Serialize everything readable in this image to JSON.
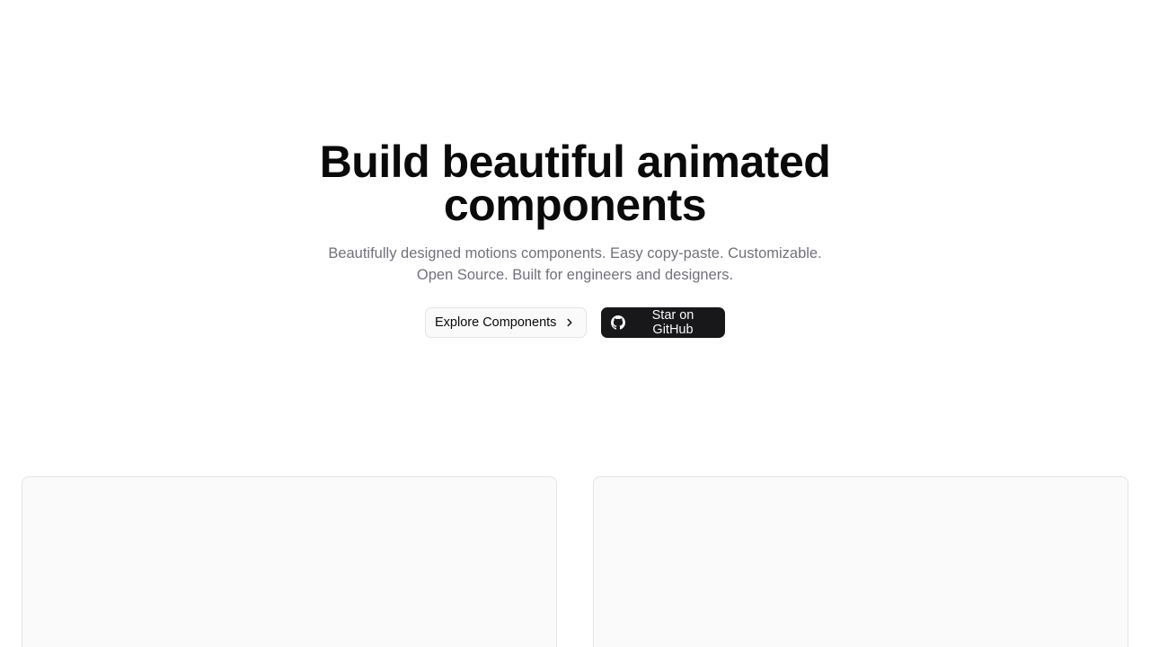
{
  "hero": {
    "title_line1": "Build beautiful animated",
    "title_line2": "components",
    "subtitle_line1": "Beautifully designed motions components. Easy copy-paste. Customizable.",
    "subtitle_line2": "Open Source. Built for engineers and designers."
  },
  "actions": {
    "explore_label": "Explore Components",
    "explore_icon": "chevron-right-icon",
    "github_label": "Star on GitHub",
    "github_icon": "github-icon"
  },
  "colors": {
    "background": "#ffffff",
    "heading": "#0a0a0a",
    "muted_text": "#71717a",
    "dark_button": "#18181b",
    "card_background": "#fafafa",
    "border": "#e4e4e7"
  }
}
